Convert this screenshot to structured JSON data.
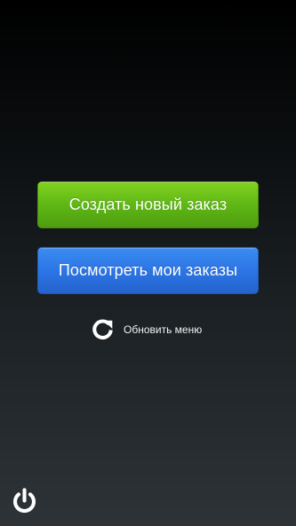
{
  "buttons": {
    "create_order_label": "Создать новый заказ",
    "view_orders_label": "Посмотреть мои заказы"
  },
  "refresh": {
    "label": "Обновить меню",
    "icon": "refresh-icon"
  },
  "power": {
    "icon": "power-icon"
  },
  "colors": {
    "green_button": "#5fb715",
    "blue_button": "#2c75e6",
    "text": "#ffffff"
  }
}
